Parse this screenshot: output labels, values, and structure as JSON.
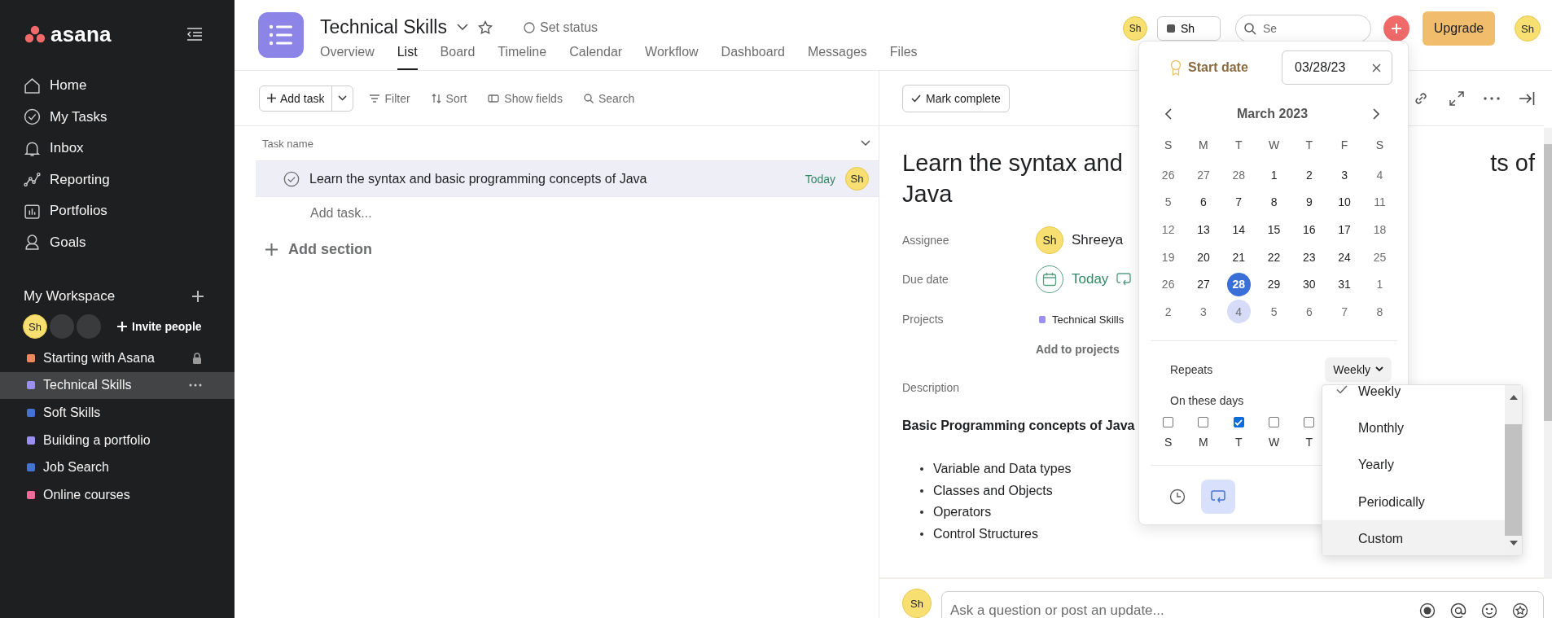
{
  "sidebar": {
    "logo": "asana",
    "nav": [
      {
        "kind": "home",
        "label": "Home"
      },
      {
        "kind": "tasks",
        "label": "My Tasks"
      },
      {
        "kind": "inbox",
        "label": "Inbox"
      },
      {
        "kind": "reporting",
        "label": "Reporting"
      },
      {
        "kind": "portfolios",
        "label": "Portfolios"
      },
      {
        "kind": "goals",
        "label": "Goals"
      }
    ],
    "workspace": {
      "title": "My Workspace",
      "members": [
        {
          "kind": "user",
          "initials": "Sh"
        },
        {
          "kind": "empty"
        },
        {
          "kind": "empty"
        }
      ],
      "invite": "Invite people"
    },
    "projects": [
      {
        "name": "Starting with Asana",
        "color": "#f1875f",
        "selected": false,
        "locked": true
      },
      {
        "name": "Technical Skills",
        "color": "#9b8ff0",
        "selected": true,
        "locked": false
      },
      {
        "name": "Soft Skills",
        "color": "#4573d2",
        "selected": false,
        "locked": false
      },
      {
        "name": "Building a portfolio",
        "color": "#9b8ff0",
        "selected": false,
        "locked": false
      },
      {
        "name": "Job Search",
        "color": "#4573d2",
        "selected": false,
        "locked": false
      },
      {
        "name": "Online courses",
        "color": "#f06a99",
        "selected": false,
        "locked": false
      }
    ]
  },
  "header": {
    "title": "Technical Skills",
    "status": "Set status",
    "tabs": [
      {
        "label": "Overview",
        "selected": false
      },
      {
        "label": "List",
        "selected": true
      },
      {
        "label": "Board",
        "selected": false
      },
      {
        "label": "Timeline",
        "selected": false
      },
      {
        "label": "Calendar",
        "selected": false
      },
      {
        "label": "Workflow",
        "selected": false
      },
      {
        "label": "Dashboard",
        "selected": false
      },
      {
        "label": "Messages",
        "selected": false
      },
      {
        "label": "Files",
        "selected": false
      }
    ],
    "member": "Sh",
    "share": "Sh",
    "search_placeholder": "Se",
    "upgrade": "Upgrade",
    "user": "Sh"
  },
  "list": {
    "toolbar": {
      "add_task": "Add task",
      "filter": "Filter",
      "sort": "Sort",
      "show_fields": "Show fields",
      "search": "Search"
    },
    "column": "Task name",
    "tasks": [
      {
        "name": "Learn the syntax and basic programming concepts of Java",
        "due": "Today",
        "assignee": "Sh",
        "selected": true,
        "completed": false
      }
    ],
    "add_task": "Add task...",
    "add_section": "Add section"
  },
  "detail": {
    "mark_complete": "Mark complete",
    "title_left": "Learn the syntax and",
    "title_right": "ts of",
    "title_line2": "Java",
    "assignee": {
      "label": "Assignee",
      "initials": "Sh",
      "name": "Shreeya"
    },
    "due": {
      "label": "Due date",
      "value": "Today"
    },
    "projects": {
      "label": "Projects",
      "items": [
        {
          "name": "Technical Skills",
          "color": "#9b8ff0"
        }
      ],
      "add": "Add to projects"
    },
    "description": {
      "label": "Description",
      "heading": "Basic Programming concepts of Java",
      "bullets": [
        "Variable and Data types",
        "Classes and Objects",
        "Operators",
        "Control Structures"
      ]
    },
    "comment": {
      "initials": "Sh",
      "placeholder": "Ask a question or post an update..."
    }
  },
  "date_picker": {
    "label": "Start date",
    "value": "03/28/23",
    "month": "March 2023",
    "weekdays": [
      "S",
      "M",
      "T",
      "W",
      "T",
      "F",
      "S"
    ],
    "weeks": [
      [
        {
          "d": "26",
          "muted": true,
          "selected": false,
          "next": false
        },
        {
          "d": "27",
          "muted": true,
          "selected": false,
          "next": false
        },
        {
          "d": "28",
          "muted": true,
          "selected": false,
          "next": false
        },
        {
          "d": "1",
          "muted": false,
          "selected": false,
          "next": false
        },
        {
          "d": "2",
          "muted": false,
          "selected": false,
          "next": false
        },
        {
          "d": "3",
          "muted": false,
          "selected": false,
          "next": false
        },
        {
          "d": "4",
          "muted": true,
          "selected": false,
          "next": false
        }
      ],
      [
        {
          "d": "5",
          "muted": true,
          "selected": false,
          "next": false
        },
        {
          "d": "6",
          "muted": false,
          "selected": false,
          "next": false
        },
        {
          "d": "7",
          "muted": false,
          "selected": false,
          "next": false
        },
        {
          "d": "8",
          "muted": false,
          "selected": false,
          "next": false
        },
        {
          "d": "9",
          "muted": false,
          "selected": false,
          "next": false
        },
        {
          "d": "10",
          "muted": false,
          "selected": false,
          "next": false
        },
        {
          "d": "11",
          "muted": true,
          "selected": false,
          "next": false
        }
      ],
      [
        {
          "d": "12",
          "muted": true,
          "selected": false,
          "next": false
        },
        {
          "d": "13",
          "muted": false,
          "selected": false,
          "next": false
        },
        {
          "d": "14",
          "muted": false,
          "selected": false,
          "next": false
        },
        {
          "d": "15",
          "muted": false,
          "selected": false,
          "next": false
        },
        {
          "d": "16",
          "muted": false,
          "selected": false,
          "next": false
        },
        {
          "d": "17",
          "muted": false,
          "selected": false,
          "next": false
        },
        {
          "d": "18",
          "muted": true,
          "selected": false,
          "next": false
        }
      ],
      [
        {
          "d": "19",
          "muted": true,
          "selected": false,
          "next": false
        },
        {
          "d": "20",
          "muted": false,
          "selected": false,
          "next": false
        },
        {
          "d": "21",
          "muted": false,
          "selected": false,
          "next": false
        },
        {
          "d": "22",
          "muted": false,
          "selected": false,
          "next": false
        },
        {
          "d": "23",
          "muted": false,
          "selected": false,
          "next": false
        },
        {
          "d": "24",
          "muted": false,
          "selected": false,
          "next": false
        },
        {
          "d": "25",
          "muted": true,
          "selected": false,
          "next": false
        }
      ],
      [
        {
          "d": "26",
          "muted": true,
          "selected": false,
          "next": false
        },
        {
          "d": "27",
          "muted": false,
          "selected": false,
          "next": false
        },
        {
          "d": "28",
          "muted": false,
          "selected": true,
          "next": false
        },
        {
          "d": "29",
          "muted": false,
          "selected": false,
          "next": false
        },
        {
          "d": "30",
          "muted": false,
          "selected": false,
          "next": false
        },
        {
          "d": "31",
          "muted": false,
          "selected": false,
          "next": false
        },
        {
          "d": "1",
          "muted": true,
          "selected": false,
          "next": false
        }
      ],
      [
        {
          "d": "2",
          "muted": true,
          "selected": false,
          "next": false
        },
        {
          "d": "3",
          "muted": true,
          "selected": false,
          "next": false
        },
        {
          "d": "4",
          "muted": true,
          "selected": false,
          "next": true
        },
        {
          "d": "5",
          "muted": true,
          "selected": false,
          "next": false
        },
        {
          "d": "6",
          "muted": true,
          "selected": false,
          "next": false
        },
        {
          "d": "7",
          "muted": true,
          "selected": false,
          "next": false
        },
        {
          "d": "8",
          "muted": true,
          "selected": false,
          "next": false
        }
      ]
    ],
    "repeats_label": "Repeats",
    "repeats_value": "Weekly",
    "days_label": "On these days",
    "days": [
      {
        "label": "S",
        "checked": false
      },
      {
        "label": "M",
        "checked": false
      },
      {
        "label": "T",
        "checked": true
      },
      {
        "label": "W",
        "checked": false
      },
      {
        "label": "T",
        "checked": false
      }
    ],
    "modes": [
      {
        "kind": "time",
        "selected": false
      },
      {
        "kind": "repeat",
        "selected": true
      }
    ]
  },
  "repeat_menu": {
    "options": [
      {
        "label": "Weekly",
        "selected": true,
        "highlighted": false
      },
      {
        "label": "Monthly",
        "selected": false,
        "highlighted": false
      },
      {
        "label": "Yearly",
        "selected": false,
        "highlighted": false
      },
      {
        "label": "Periodically",
        "selected": false,
        "highlighted": false
      },
      {
        "label": "Custom",
        "selected": false,
        "highlighted": true
      }
    ]
  }
}
